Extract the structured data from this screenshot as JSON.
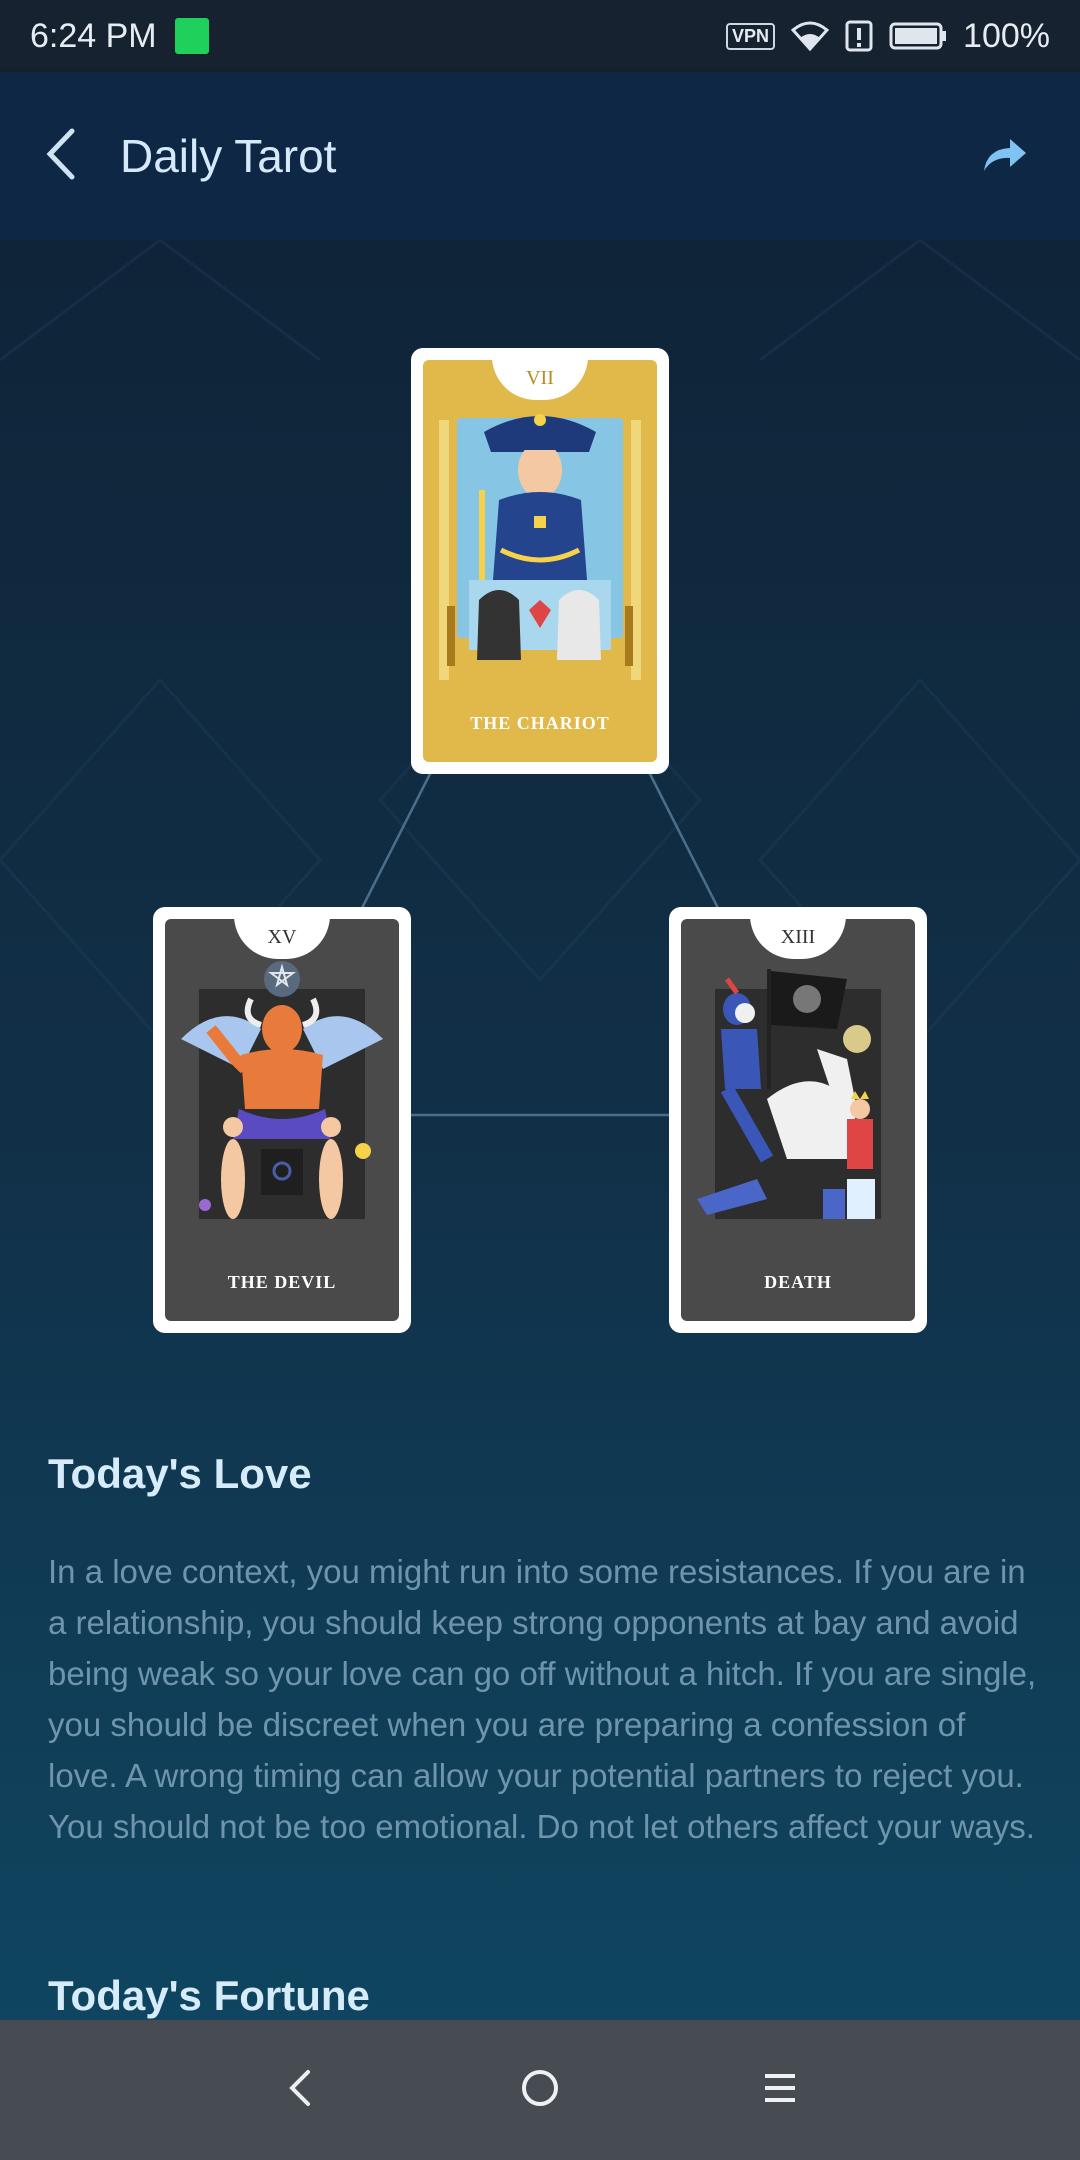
{
  "status_bar": {
    "time": "6:24 PM",
    "vpn": "VPN",
    "battery": "100%",
    "icons": [
      "sim-icon",
      "vpn-icon",
      "wifi-icon",
      "alert-icon",
      "battery-icon"
    ]
  },
  "app_bar": {
    "title": "Daily Tarot",
    "back_icon": "chevron-left-icon",
    "share_icon": "share-arrow-icon"
  },
  "cards": [
    {
      "numeral": "VII",
      "name": "THE CHARIOT",
      "color": "#e1b94a"
    },
    {
      "numeral": "XV",
      "name": "THE DEVIL",
      "color": "#4a4a4a"
    },
    {
      "numeral": "XIII",
      "name": "DEATH",
      "color": "#4a4a4a"
    }
  ],
  "love": {
    "title": "Today's Love",
    "body": "In a love context, you might run into some resistances. If you are in a relationship, you should keep strong opponents at bay and avoid being weak so your love can go off without a hitch. If you are single, you should be discreet when you are preparing a confession of love. A wrong timing can allow your potential partners to reject you. You should not be too emotional. Do not let others affect your ways."
  },
  "fortune": {
    "title": "Today's Fortune"
  },
  "nav_bar": {
    "back_icon": "back-icon",
    "home_icon": "home-icon",
    "menu_icon": "menu-icon"
  },
  "colors": {
    "accent": "#d6e9fa",
    "body_text": "#6f94ad",
    "chariot_card": "#e1b94a",
    "dark_card": "#4a4a4a",
    "share_icon": "#7fc3f2"
  }
}
